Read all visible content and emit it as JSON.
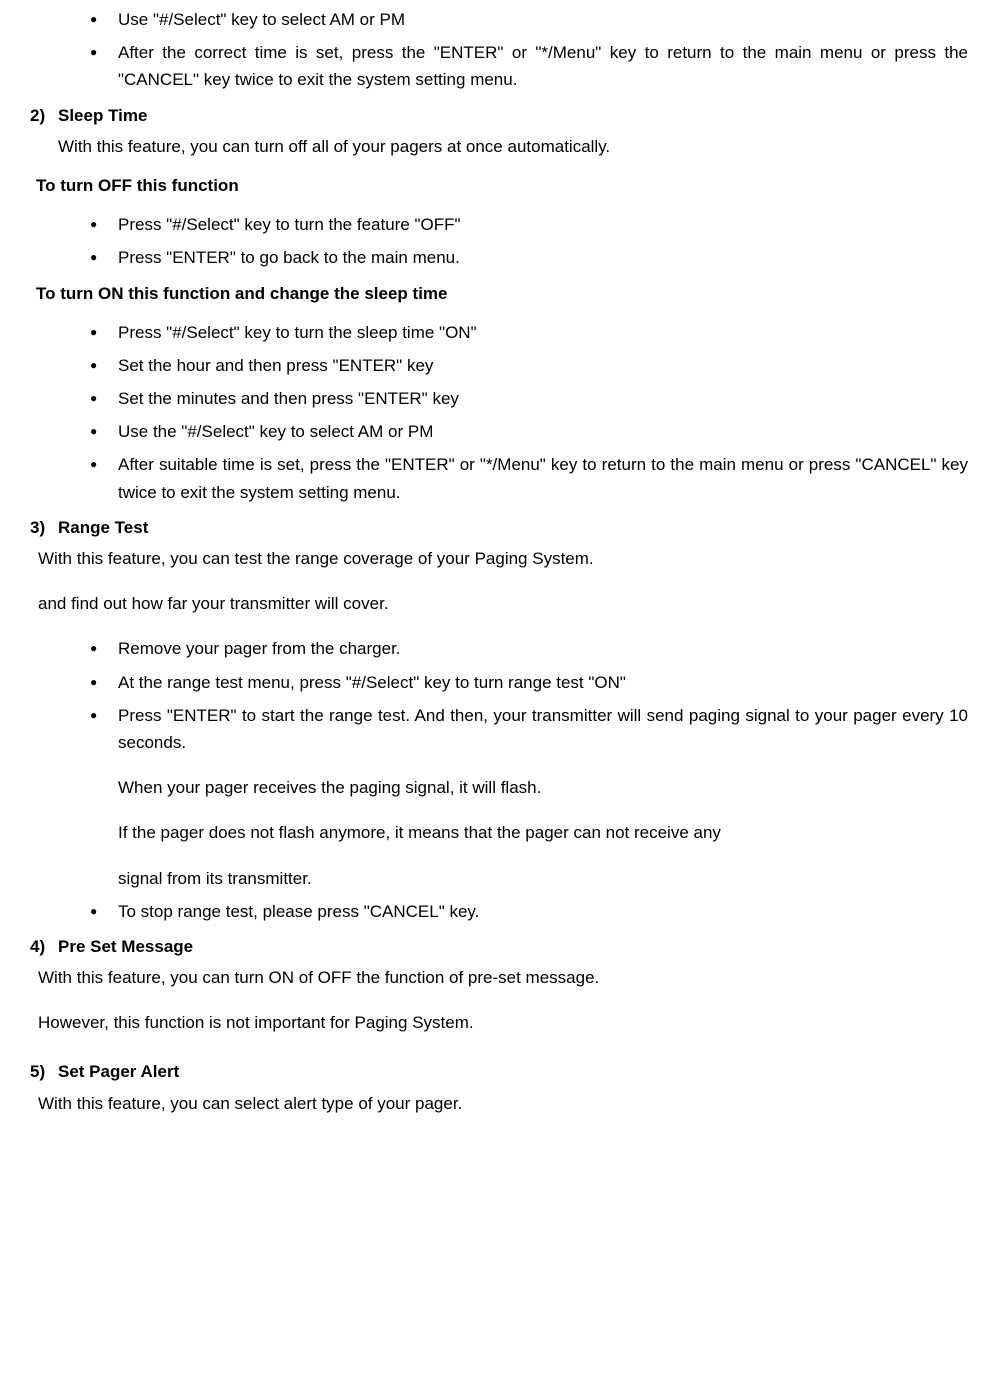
{
  "top_bullets": [
    "Use \"#/Select\" key to select AM or PM",
    "After the correct time is set, press the \"ENTER\" or \"*/Menu\" key to return to the main menu or press the \"CANCEL\" key twice to exit the system setting menu."
  ],
  "s2": {
    "num": "2)",
    "title": "Sleep Time",
    "intro": "With this feature, you can turn off all of your pagers at once automatically.",
    "off_heading": "To turn OFF this function",
    "off_bullets": [
      "Press \"#/Select\" key to turn the feature \"OFF\"",
      "Press \"ENTER\" to go back to the main menu."
    ],
    "on_heading": "To turn ON this function and change the sleep time",
    "on_bullets": [
      "Press \"#/Select\" key to turn the sleep time \"ON\"",
      "Set the hour and then press \"ENTER\" key",
      "Set the minutes and then press \"ENTER\" key",
      "Use the \"#/Select\" key to select AM or PM",
      "After suitable time is set, press the \"ENTER\" or \"*/Menu\" key to return to the main menu or press \"CANCEL\" key twice to exit the system setting menu."
    ]
  },
  "s3": {
    "num": "3)",
    "title": "Range Test",
    "intro1": "With this feature, you can test the range coverage of your Paging System.",
    "intro2": "and find out how far your transmitter will cover.",
    "bullets": [
      "Remove your pager from the charger.",
      "At the range test menu, press \"#/Select\" key to turn range test \"ON\""
    ],
    "bullet3_main": "Press \"ENTER\" to start the range test. And then, your transmitter will send paging signal to your pager every 10 seconds.",
    "bullet3_extra1": "When your pager receives the paging signal, it will flash.",
    "bullet3_extra2": "If the pager does not flash anymore, it means that the pager can not receive any",
    "bullet3_extra3": "signal from its transmitter.",
    "bullet4": "To stop range test, please press \"CANCEL\" key."
  },
  "s4": {
    "num": "4)",
    "title": "Pre Set Message",
    "intro1": "With this feature, you can turn ON of OFF the function of pre-set message.",
    "intro2": "However, this function is not important for Paging System."
  },
  "s5": {
    "num": "5)",
    "title": "Set Pager Alert",
    "intro": "With this feature, you can select alert type of your pager."
  }
}
